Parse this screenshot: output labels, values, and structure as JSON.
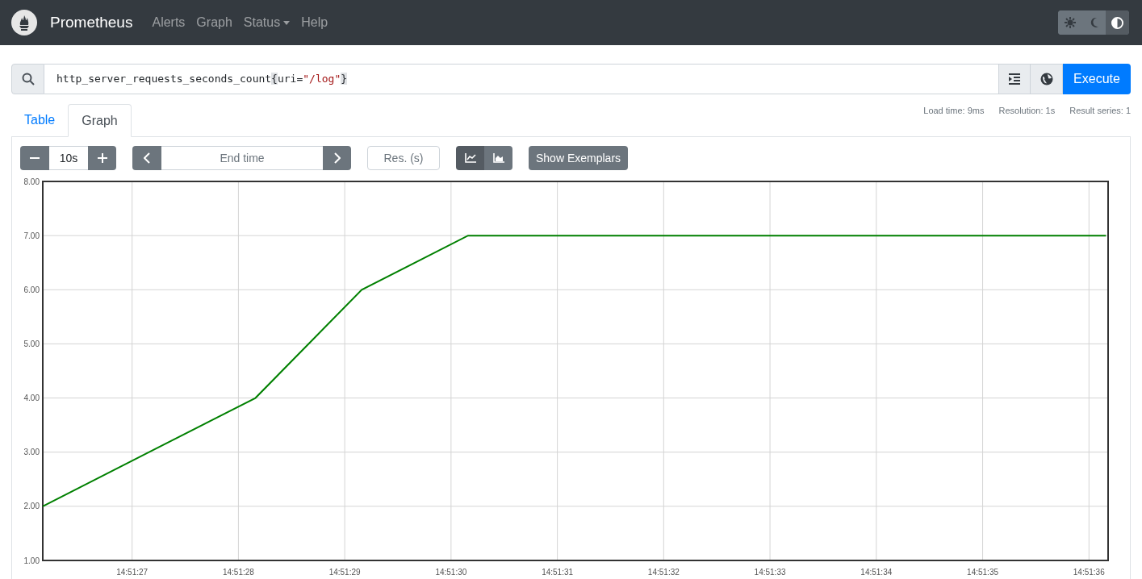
{
  "navbar": {
    "brand": "Prometheus",
    "links": [
      {
        "label": "Alerts",
        "kind": "link"
      },
      {
        "label": "Graph",
        "kind": "link"
      },
      {
        "label": "Status",
        "kind": "dropdown"
      },
      {
        "label": "Help",
        "kind": "link"
      }
    ],
    "theme_buttons": [
      {
        "kind": "light",
        "selected": false
      },
      {
        "kind": "dark",
        "selected": false
      },
      {
        "kind": "auto",
        "selected": true
      }
    ]
  },
  "query": {
    "metric": "http_server_requests_seconds_count",
    "open_brace": "{",
    "label_name": "uri",
    "operator": "=",
    "label_value": "\"/log\"",
    "close_brace": "}",
    "execute": "Execute"
  },
  "stats": [
    "Load time: 9ms",
    "Resolution: 1s",
    "Result series: 1"
  ],
  "tabs": [
    {
      "label": "Table",
      "selected": false
    },
    {
      "label": "Graph",
      "selected": true
    }
  ],
  "controls": {
    "range": "10s",
    "end_time_placeholder": "End time",
    "resolution_placeholder": "Res. (s)",
    "chart_modes": [
      {
        "kind": "line",
        "selected": true
      },
      {
        "kind": "stacked",
        "selected": false
      }
    ],
    "exemplars": "Show Exemplars"
  },
  "chart_data": {
    "type": "line",
    "x": [
      53486.16,
      53487.16,
      53488.16,
      53489.16,
      53490.16,
      53491.16,
      53492.16,
      53493.16,
      53494.16,
      53495.16,
      53496.16
    ],
    "series": [
      {
        "color": "#008000",
        "values": [
          2,
          3,
          4,
          6,
          7,
          7,
          7,
          7,
          7,
          7,
          7
        ]
      }
    ],
    "grid": true,
    "xlim": [
      53486.16,
      53496.18
    ],
    "ylim": [
      1,
      8
    ],
    "xticks": [
      {
        "value": 53487,
        "label": "14:51:27"
      },
      {
        "value": 53488,
        "label": "14:51:28"
      },
      {
        "value": 53489,
        "label": "14:51:29"
      },
      {
        "value": 53490,
        "label": "14:51:30"
      },
      {
        "value": 53491,
        "label": "14:51:31"
      },
      {
        "value": 53492,
        "label": "14:51:32"
      },
      {
        "value": 53493,
        "label": "14:51:33"
      },
      {
        "value": 53494,
        "label": "14:51:34"
      },
      {
        "value": 53495,
        "label": "14:51:35"
      },
      {
        "value": 53496,
        "label": "14:51:36"
      }
    ],
    "yticks": [
      {
        "value": 1,
        "label": "1.00"
      },
      {
        "value": 2,
        "label": "2.00"
      },
      {
        "value": 3,
        "label": "3.00"
      },
      {
        "value": 4,
        "label": "4.00"
      },
      {
        "value": 5,
        "label": "5.00"
      },
      {
        "value": 6,
        "label": "6.00"
      },
      {
        "value": 7,
        "label": "7.00"
      },
      {
        "value": 8,
        "label": "8.00"
      }
    ]
  }
}
